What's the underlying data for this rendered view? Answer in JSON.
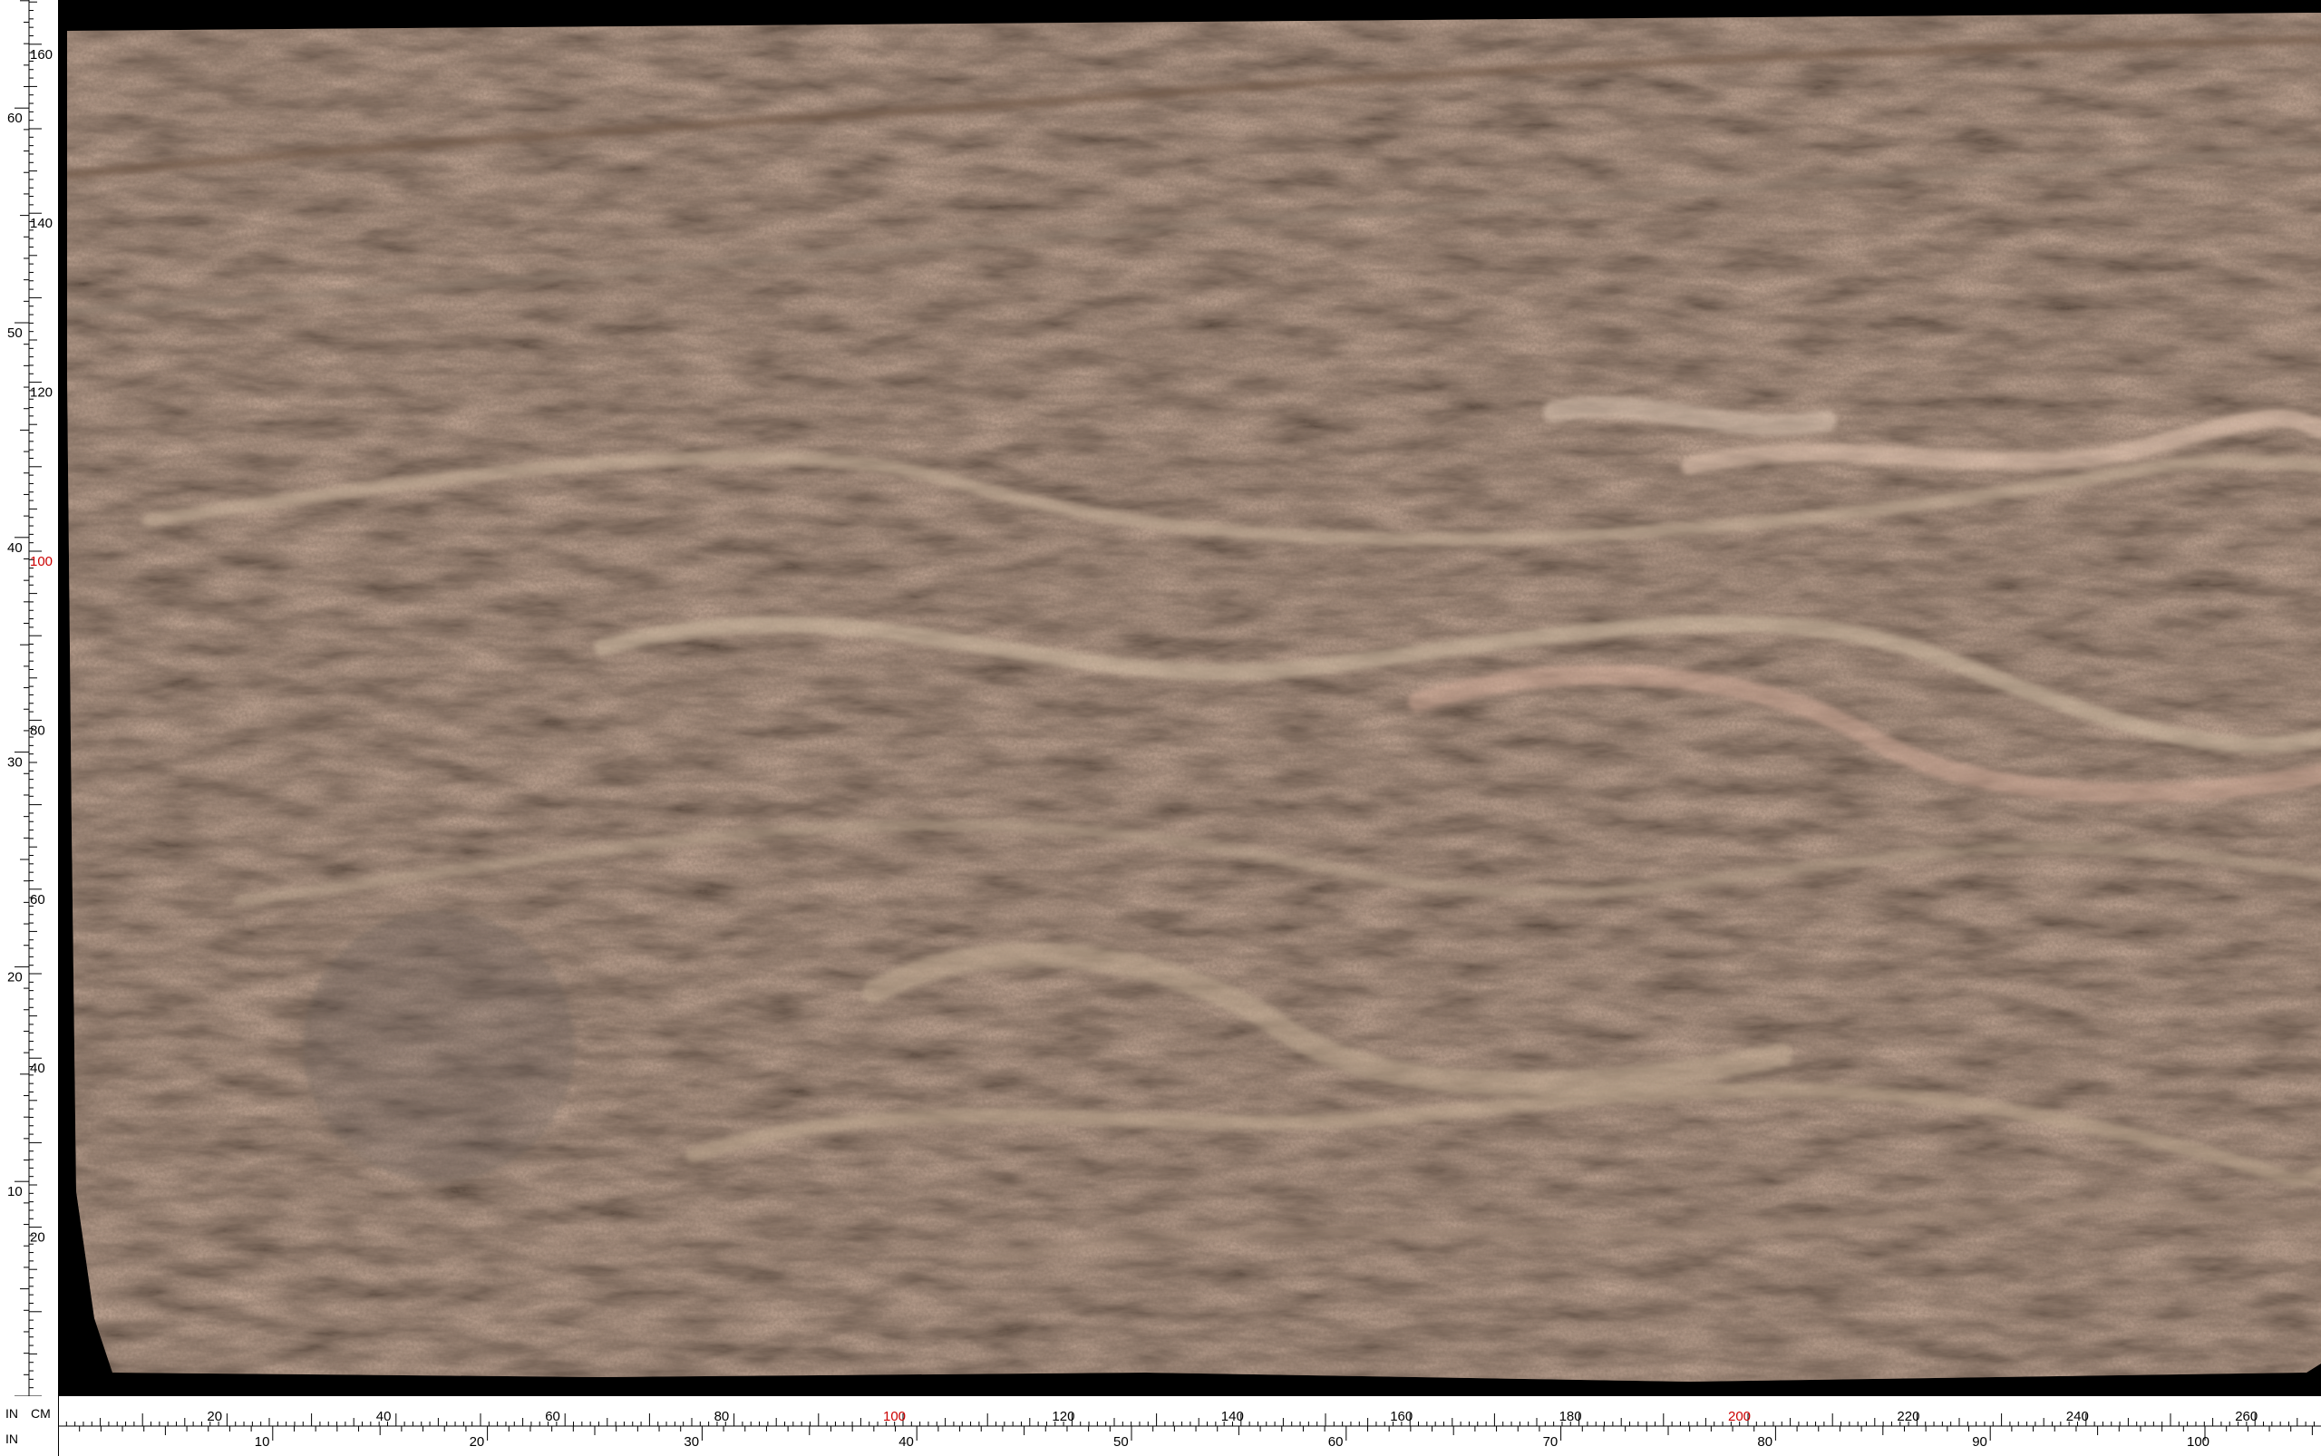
{
  "image": {
    "subject": "polished granite slab",
    "palette": {
      "base": "#3a2a21",
      "dark": "#1f1510",
      "vein_light": "#c9b39a",
      "vein_pink": "#e3b9a3",
      "vein_grey": "#8f7f70"
    }
  },
  "ruler": {
    "unit_in": "IN",
    "unit_cm": "CM",
    "bottom_cm_labels": [
      "20",
      "40",
      "60",
      "80",
      "100",
      "120",
      "140",
      "160",
      "180",
      "200",
      "220",
      "240",
      "260"
    ],
    "bottom_in_labels": [
      "10",
      "20",
      "30",
      "40",
      "50",
      "60",
      "70",
      "80",
      "90",
      "100"
    ],
    "left_cm_labels": [
      "160",
      "140",
      "120",
      "100",
      "80",
      "60",
      "40",
      "20"
    ],
    "left_in_labels": [
      "60",
      "50",
      "40",
      "30",
      "20",
      "10"
    ],
    "highlight_labels": [
      "100",
      "200",
      "100"
    ],
    "highlight_color": "#cc0000"
  }
}
